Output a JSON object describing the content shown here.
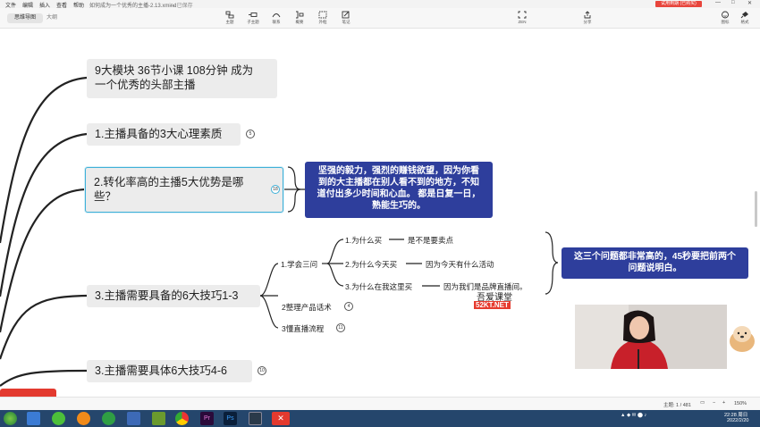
{
  "menu": {
    "items": [
      "文件",
      "编辑",
      "插入",
      "查看",
      "帮助"
    ],
    "doc_title": "如何成为一个优秀的主播-2.13.xmind",
    "save_status": "— 已保存",
    "vip_badge": "试用到期 (已购买)"
  },
  "toolbar": {
    "view_tabs": [
      "思维导图",
      "大纲"
    ],
    "tools": [
      {
        "label": "主题",
        "icon": "topic-icon"
      },
      {
        "label": "子主题",
        "icon": "subtopic-icon"
      },
      {
        "label": "联系",
        "icon": "relationship-icon"
      },
      {
        "label": "概要",
        "icon": "summary-icon"
      },
      {
        "label": "外框",
        "icon": "boundary-icon"
      },
      {
        "label": "笔记",
        "icon": "note-icon"
      }
    ],
    "zen_label": "ZEN",
    "share_label": "分享",
    "right_tools": [
      {
        "label": "图标",
        "icon": "emoji-icon"
      },
      {
        "label": "格式",
        "icon": "format-brush-icon"
      }
    ]
  },
  "mindmap": {
    "top_node": [
      "9大模块 36节小课 108分钟 成为",
      "一个优秀的头部主播"
    ],
    "n1": {
      "label": "1.主播具备的3大心理素质",
      "count": "5"
    },
    "n2": {
      "label": [
        "2.转化率高的主播5大优势是哪",
        "些？"
      ],
      "count": "18"
    },
    "note1": [
      "坚强的毅力，强烈的赚钱欲望，因为你看",
      "到的大主播都在别人看不到的地方，不知",
      "道付出多少时间和心血。 都是日复一日，",
      "熟能生巧的。"
    ],
    "n3": {
      "label": "3.主播需要具备的6大技巧1-3",
      "children": [
        {
          "label": "1.学会三问",
          "questions": [
            {
              "q": "1.为什么买",
              "a": "是不是要卖点"
            },
            {
              "q": "2.为什么今天买",
              "a": "因为今天有什么活动"
            },
            {
              "q": "3.为什么在我这里买",
              "a": "因为我们是品牌直播间。"
            }
          ]
        },
        {
          "label": "2整理产品话术",
          "count": "4"
        },
        {
          "label": "3懂直播流程",
          "count": "11"
        }
      ]
    },
    "note2": [
      "这三个问题都非常高的，45秒要把前两个",
      "问题说明白。"
    ],
    "n4": {
      "label": "3.主播需要具体6大技巧4-6",
      "count": "10"
    }
  },
  "watermark": {
    "line1": "吾爱课堂",
    "line2": "52KT.NET"
  },
  "status": {
    "topic_count": "主题: 1 / 481",
    "zoom": "150%"
  },
  "taskbar": {
    "time": "22:28 周日",
    "date": "2022/2/20"
  },
  "colors": {
    "note_bg": "#2e3e9c",
    "node_bg": "#ececec",
    "selected_border": "#3fb0d8",
    "taskbar": "#25466c"
  }
}
